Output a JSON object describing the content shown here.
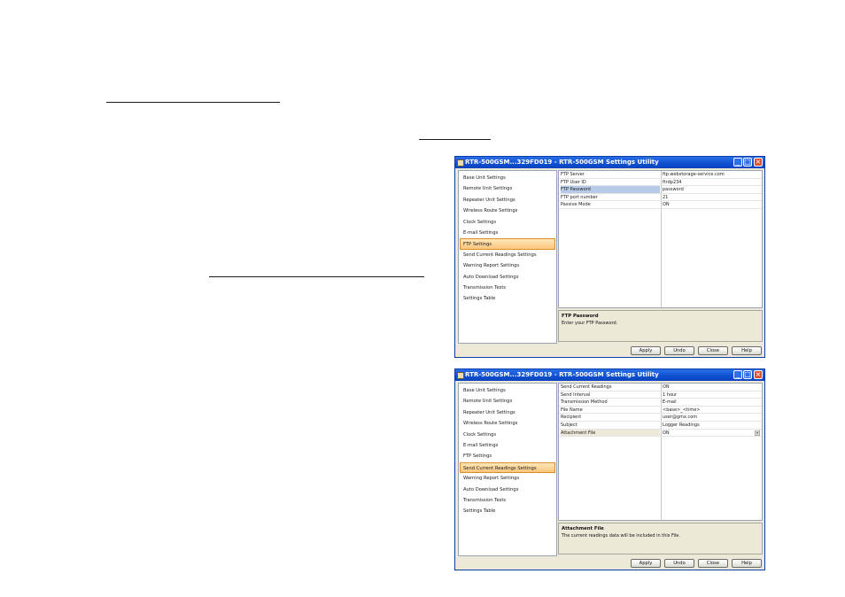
{
  "window1": {
    "title": "RTR-500GSM...329FD019 - RTR-500GSM Settings Utility",
    "nav": [
      "Base Unit Settings",
      "Remote Unit Settings",
      "Repeater Unit Settings",
      "Wireless Route Settings",
      "Clock Settings",
      "E-mail Settings",
      "FTP Settings",
      "Send Current Readings Settings",
      "Warning Report Settings",
      "Auto Download Settings",
      "Transmission Tests",
      "Settings Table"
    ],
    "selected_nav": "FTP Settings",
    "rows": [
      {
        "key": "FTP Server",
        "value": "ftp.webstorage-service.com"
      },
      {
        "key": "FTP User ID",
        "value": "ftrdp234"
      },
      {
        "key": "FTP Password",
        "value": "password"
      },
      {
        "key": "FTP port number",
        "value": "21"
      },
      {
        "key": "Passive Mode",
        "value": "ON"
      }
    ],
    "desc_title": "FTP Password",
    "desc_text": "Enter your FTP Password.",
    "buttons": {
      "apply": "Apply",
      "undo": "Undo",
      "close": "Close",
      "help": "Help"
    }
  },
  "window2": {
    "title": "RTR-500GSM...329FD019 - RTR-500GSM Settings Utility",
    "nav": [
      "Base Unit Settings",
      "Remote Unit Settings",
      "Repeater Unit Settings",
      "Wireless Route Settings",
      "Clock Settings",
      "E-mail Settings",
      "FTP Settings",
      "Send Current Readings Settings",
      "Warning Report Settings",
      "Auto Download Settings",
      "Transmission Tests",
      "Settings Table"
    ],
    "selected_nav": "Send Current Readings Settings",
    "rows": [
      {
        "key": "Send Current Readings",
        "value": "ON"
      },
      {
        "key": "Send Interval",
        "value": "1 hour"
      },
      {
        "key": "Transmission Method",
        "value": "E-mail"
      },
      {
        "key": "File Name",
        "value": "<base>_<time>"
      },
      {
        "key": "Recipient",
        "value": "user@gmx.com"
      },
      {
        "key": "Subject",
        "value": "Logger Readings"
      },
      {
        "key": "Attachment File",
        "value": "ON"
      }
    ],
    "desc_title": "Attachment File",
    "desc_text": "The current readings data will be included in this File.",
    "buttons": {
      "apply": "Apply",
      "undo": "Undo",
      "close": "Close",
      "help": "Help"
    }
  },
  "colors": {
    "titlebar": "#0f4fd0",
    "selected_nav": "#fbc57c",
    "highlight_row": "#b7cbe8",
    "dialog_bg": "#ece9d8"
  }
}
